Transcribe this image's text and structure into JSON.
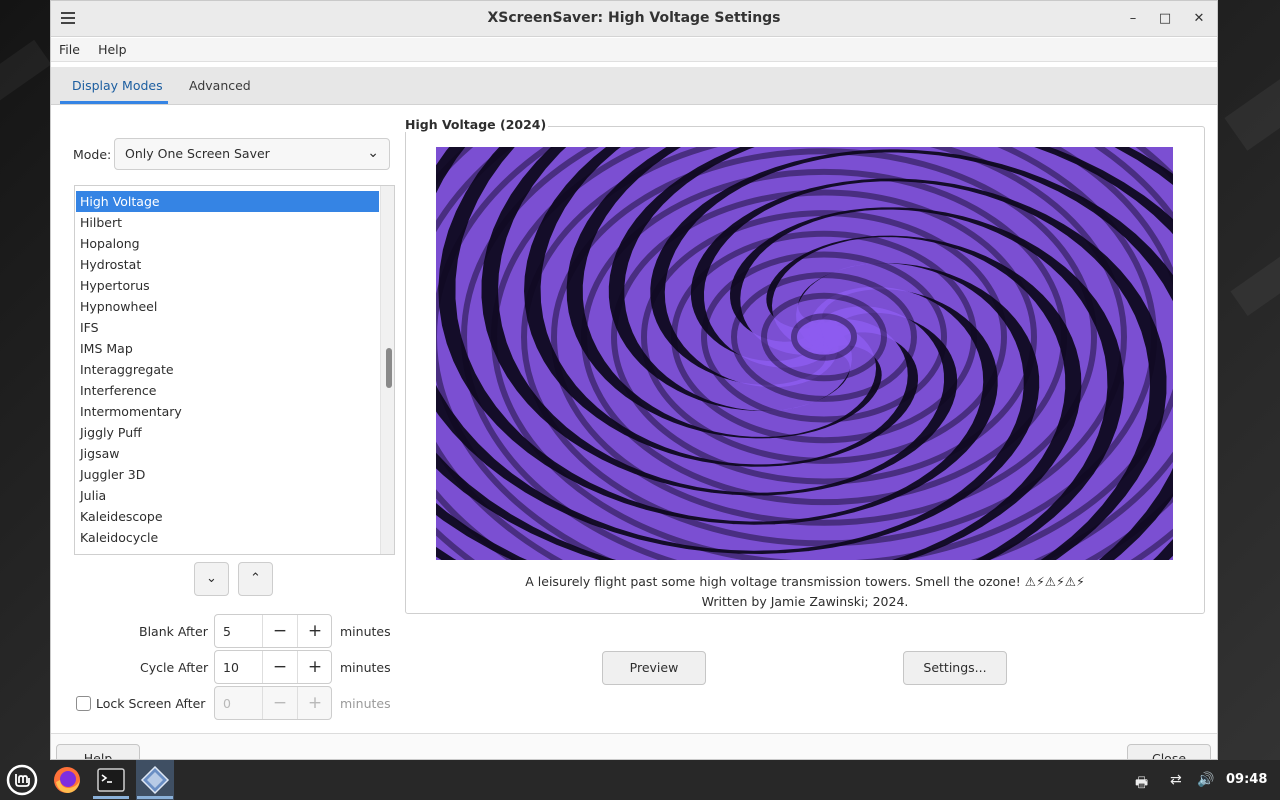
{
  "window": {
    "title": "XScreenSaver: High Voltage Settings",
    "minimize_glyph": "–",
    "maximize_glyph": "□",
    "close_glyph": "✕"
  },
  "menu": {
    "file": "File",
    "help": "Help"
  },
  "tabs": [
    {
      "label": "Display Modes",
      "active": true
    },
    {
      "label": "Advanced",
      "active": false
    }
  ],
  "mode": {
    "label": "Mode:",
    "selected": "Only One Screen Saver"
  },
  "savers": [
    "High Voltage",
    "Hilbert",
    "Hopalong",
    "Hydrostat",
    "Hypertorus",
    "Hypnowheel",
    "IFS",
    "IMS Map",
    "Interaggregate",
    "Interference",
    "Intermomentary",
    "Jiggly Puff",
    "Jigsaw",
    "Juggler 3D",
    "Julia",
    "Kaleidescope",
    "Kaleidocycle"
  ],
  "selected_saver": "High Voltage",
  "timing": {
    "blank_after": {
      "label": "Blank After",
      "value": "5",
      "unit": "minutes"
    },
    "cycle_after": {
      "label": "Cycle After",
      "value": "10",
      "unit": "minutes"
    },
    "lock_after": {
      "label": "Lock Screen After",
      "value": "0",
      "unit": "minutes",
      "checked": false
    }
  },
  "preview": {
    "frame_title": "High Voltage (2024)",
    "description": "A leisurely flight past some high voltage transmission towers. Smell the ozone! ⚠⚡⚠⚡⚠⚡",
    "author": "Written by Jamie Zawinski; 2024."
  },
  "buttons": {
    "preview": "Preview",
    "settings": "Settings...",
    "help": "Help",
    "close": "Close"
  },
  "taskbar": {
    "clock": "09:48"
  },
  "colors": {
    "accent": "#3584e4",
    "spiral_light": "#8d5cf0",
    "spiral_dark": "#140d29"
  }
}
